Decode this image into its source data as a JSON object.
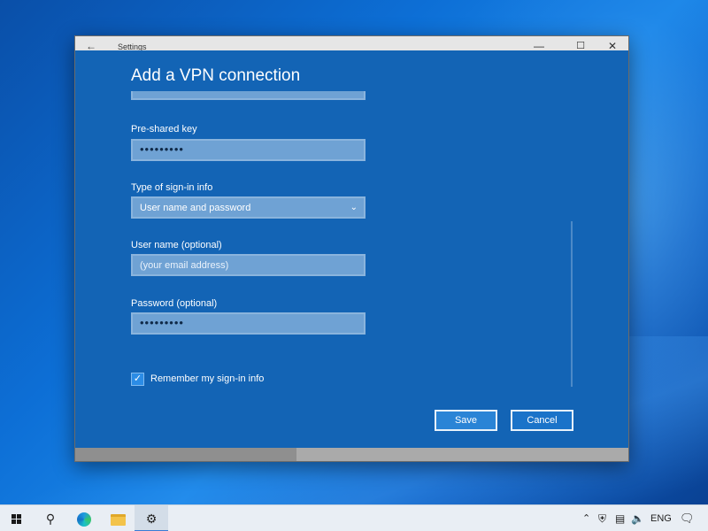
{
  "window": {
    "title": "Settings",
    "back_glyph": "←",
    "minimize_glyph": "—",
    "maximize_glyph": "☐",
    "close_glyph": "✕"
  },
  "dialog": {
    "title": "Add a VPN connection",
    "fields": {
      "psk": {
        "label": "Pre-shared key",
        "value": "•••••••••"
      },
      "signin_type": {
        "label": "Type of sign-in info",
        "value": "User name and password"
      },
      "username": {
        "label": "User name (optional)",
        "placeholder": "(your email address)"
      },
      "password": {
        "label": "Password (optional)",
        "value": "•••••••••"
      }
    },
    "remember": {
      "label": "Remember my sign-in info",
      "checked": true
    },
    "buttons": {
      "save": "Save",
      "cancel": "Cancel"
    }
  },
  "taskbar": {
    "icons": [
      "windows-start-icon",
      "search-icon",
      "edge-icon",
      "file-explorer-icon",
      "settings-icon"
    ],
    "tray": {
      "language": "ENG"
    }
  },
  "colors": {
    "dialog_bg": "#1364b5",
    "input_bg": "#6fa2d4",
    "accent": "#2a84d6"
  }
}
